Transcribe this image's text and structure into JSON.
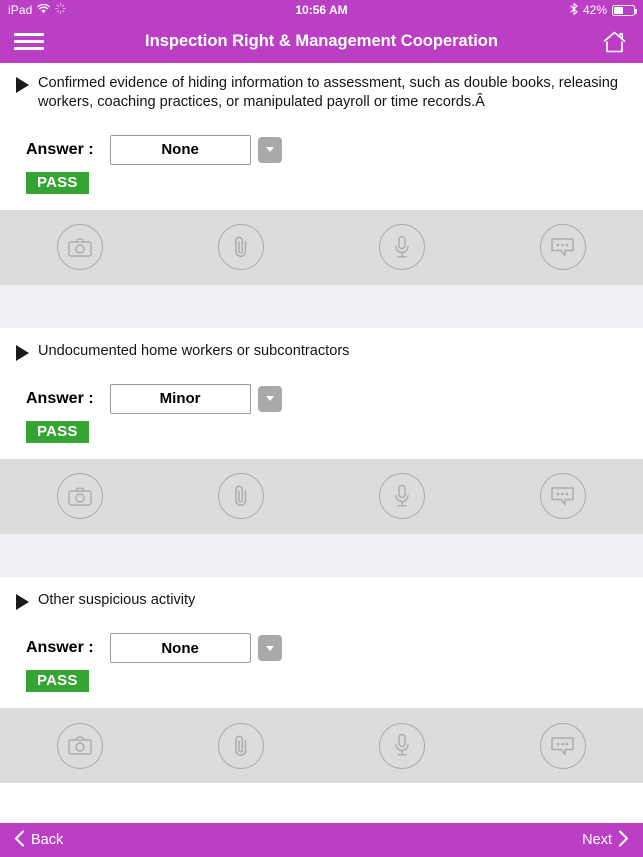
{
  "statusbar": {
    "device": "iPad",
    "wifi_icon": "wifi-icon",
    "sync_icon": "sync-activity-icon",
    "time": "10:56 AM",
    "bluetooth_icon": "bluetooth-icon",
    "battery_percent": "42%",
    "battery_level": 42
  },
  "header": {
    "menu_icon": "hamburger-menu-icon",
    "title": "Inspection Right & Management Cooperation",
    "home_icon": "home-icon",
    "background_color": "#BB3FC4"
  },
  "answer_label": "Answer  :",
  "pass_label": "PASS",
  "pass_color": "#34A532",
  "attachment_icons": [
    {
      "name": "camera-icon",
      "label": "Camera"
    },
    {
      "name": "paperclip-icon",
      "label": "Attachment"
    },
    {
      "name": "microphone-icon",
      "label": "Voice note"
    },
    {
      "name": "comment-icon",
      "label": "Comment"
    }
  ],
  "questions": [
    {
      "text": "Confirmed evidence of hiding information to assessment, such as double books, releasing workers, coaching practices, or manipulated payroll or time records.Â",
      "answer": "None",
      "status": "PASS"
    },
    {
      "text": "Undocumented home workers or subcontractors",
      "answer": "Minor",
      "status": "PASS"
    },
    {
      "text": "Other suspicious activity",
      "answer": "None",
      "status": "PASS"
    }
  ],
  "footer": {
    "back_label": "Back",
    "next_label": "Next",
    "back_icon": "chevron-left-icon",
    "next_icon": "chevron-right-icon"
  }
}
